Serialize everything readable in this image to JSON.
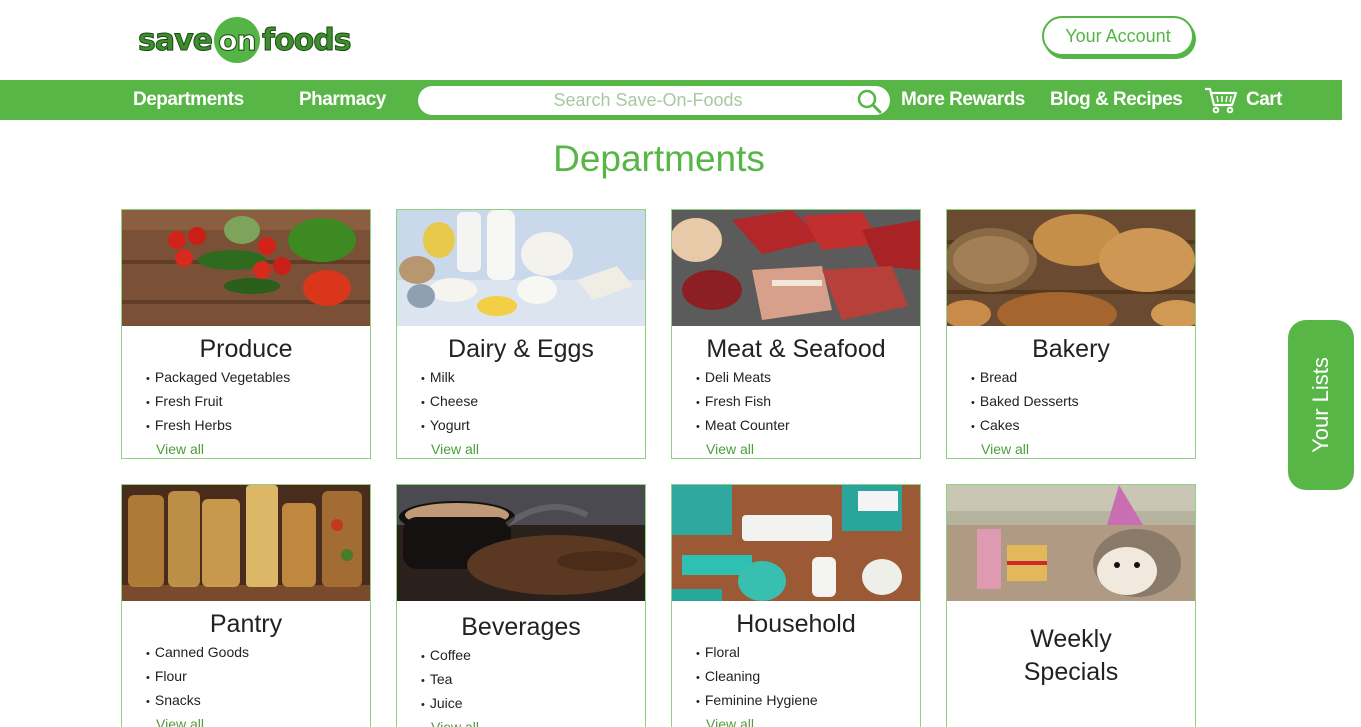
{
  "logo": {
    "part1": "save",
    "part2": "on",
    "part3": "foods"
  },
  "header": {
    "account_label": "Your Account"
  },
  "nav": {
    "departments": "Departments",
    "pharmacy": "Pharmacy",
    "search_placeholder": "Search Save-On-Foods",
    "more_rewards": "More Rewards",
    "blog": "Blog & Recipes",
    "cart": "Cart"
  },
  "page": {
    "title": "Departments"
  },
  "departments": [
    {
      "name": "Produce",
      "items": [
        "Packaged Vegetables",
        "Fresh Fruit",
        "Fresh Herbs"
      ],
      "view_all": "View all"
    },
    {
      "name": "Dairy & Eggs",
      "items": [
        "Milk",
        "Cheese",
        "Yogurt"
      ],
      "view_all": "View all"
    },
    {
      "name": "Meat & Seafood",
      "items": [
        "Deli Meats",
        "Fresh Fish",
        "Meat Counter"
      ],
      "view_all": "View all"
    },
    {
      "name": "Bakery",
      "items": [
        "Bread",
        "Baked Desserts",
        "Cakes"
      ],
      "view_all": "View all"
    },
    {
      "name": "Pantry",
      "items": [
        "Canned Goods",
        "Flour",
        "Snacks"
      ],
      "view_all": "View all"
    },
    {
      "name": "Beverages",
      "items": [
        "Coffee",
        "Tea",
        "Juice"
      ],
      "view_all": "View all"
    },
    {
      "name": "Household",
      "items": [
        "Floral",
        "Cleaning",
        "Feminine Hygiene"
      ],
      "view_all": "View all"
    }
  ],
  "specials": {
    "line1": "Weekly",
    "line2": "Specials"
  },
  "sidebar_tab": {
    "label": "Your Lists"
  },
  "colors": {
    "brand_green": "#57b646",
    "text": "#222222",
    "border": "#8fd184"
  }
}
